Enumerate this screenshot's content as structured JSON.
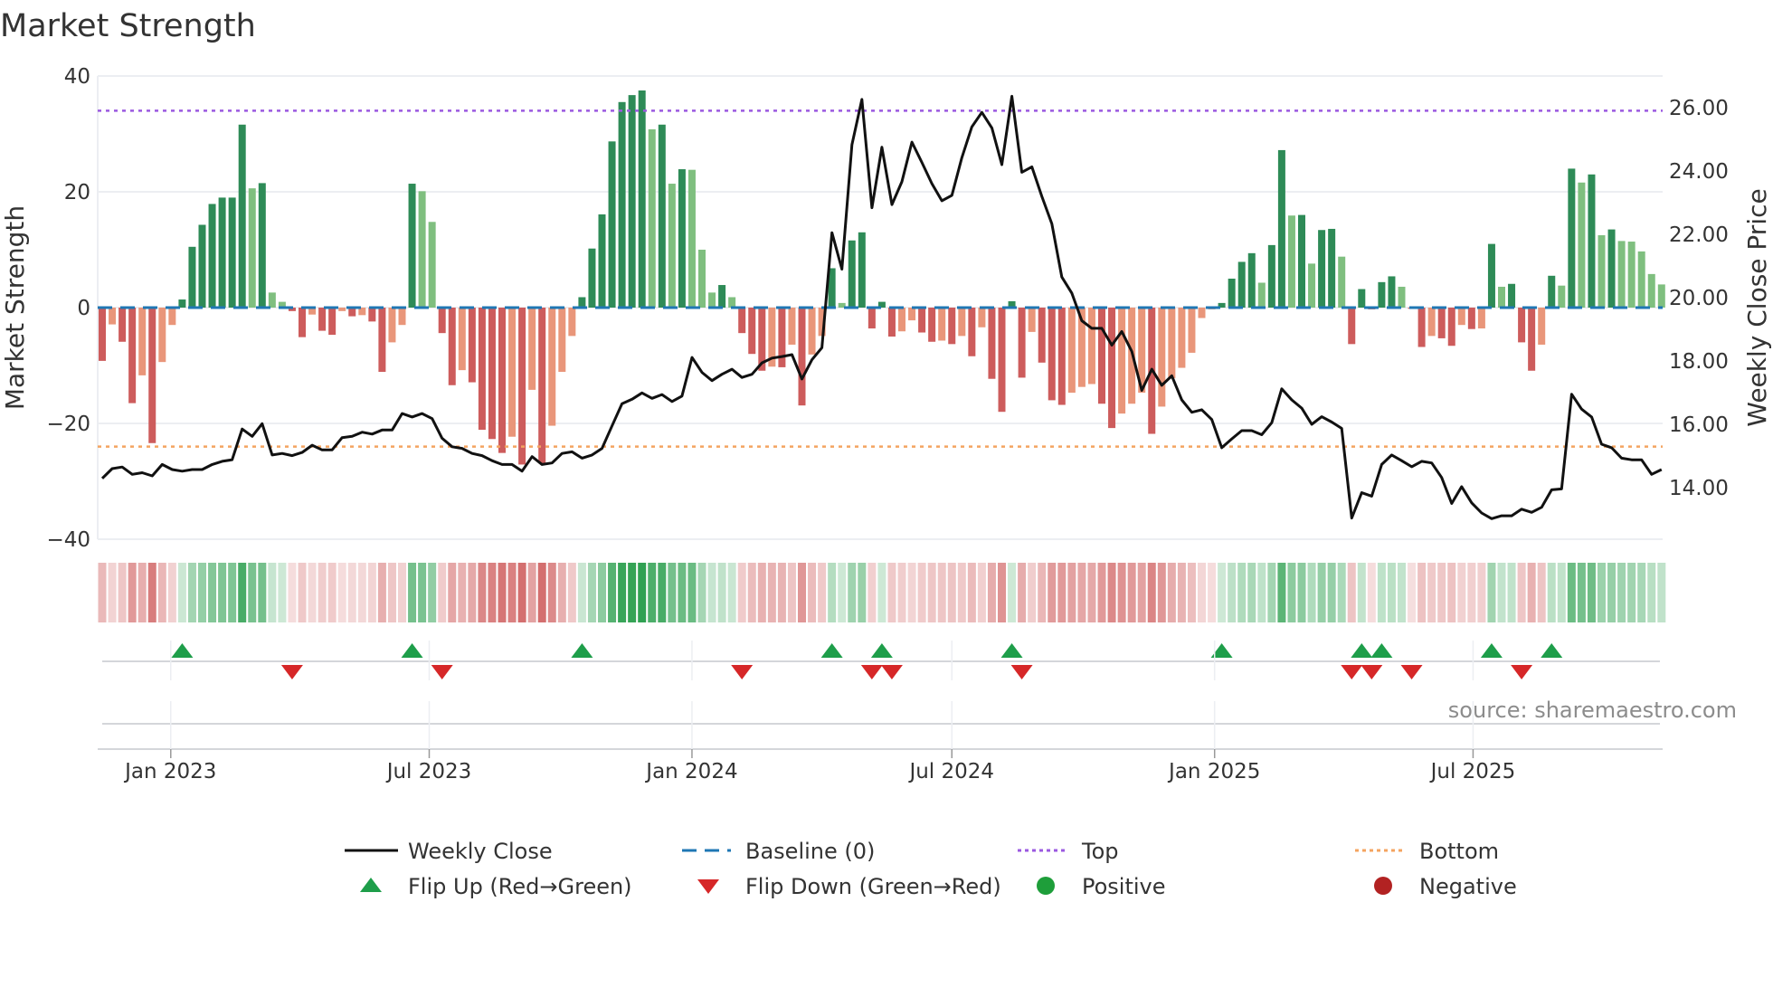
{
  "chart_data": {
    "type": "bar",
    "title": "Market Strength",
    "ylabel": "Market Strength",
    "y2label": "Weekly Close Price",
    "ylim": [
      -40,
      40
    ],
    "y2lim": [
      12.37,
      27.0
    ],
    "yticks": [
      40,
      20,
      0,
      -20,
      -40
    ],
    "y2ticks": [
      14,
      16,
      18,
      20,
      22,
      24,
      26
    ],
    "grid": true,
    "start_date": "2022-11-14",
    "frequency": "weekly",
    "xticks": [
      {
        "date": "2023-01-01",
        "label": "Jan 2023"
      },
      {
        "date": "2023-07-01",
        "label": "Jul 2023"
      },
      {
        "date": "2024-01-01",
        "label": "Jan 2024"
      },
      {
        "date": "2024-07-01",
        "label": "Jul 2024"
      },
      {
        "date": "2025-01-01",
        "label": "Jan 2025"
      },
      {
        "date": "2025-07-01",
        "label": "Jul 2025"
      }
    ],
    "top_level": 34,
    "bottom_level": -24,
    "baseline": 0,
    "strength": [
      -9.2,
      -2.9,
      -5.9,
      -16.5,
      -11.7,
      -23.4,
      -9.4,
      -3.0,
      1.4,
      10.5,
      14.3,
      17.9,
      19.0,
      19.0,
      31.6,
      20.6,
      21.5,
      2.6,
      1.0,
      -0.6,
      -5.1,
      -1.2,
      -4.0,
      -4.7,
      -0.6,
      -1.5,
      -1.3,
      -2.4,
      -11.1,
      -6.0,
      -3.0,
      21.4,
      20.1,
      14.8,
      -4.4,
      -13.4,
      -10.8,
      -12.9,
      -21.1,
      -22.7,
      -25.1,
      -22.3,
      -27.1,
      -14.2,
      -26.9,
      -20.4,
      -11.1,
      -4.9,
      1.8,
      10.2,
      16.1,
      28.7,
      35.5,
      36.7,
      37.5,
      30.8,
      31.6,
      21.4,
      23.9,
      23.8,
      10.0,
      2.6,
      3.9,
      1.8,
      -4.4,
      -8.0,
      -10.9,
      -10.2,
      -10.3,
      -6.4,
      -16.9,
      -8.1,
      -4.9,
      6.8,
      0.8,
      11.6,
      13.0,
      -3.6,
      1.0,
      -5.0,
      -4.1,
      -2.2,
      -4.3,
      -5.9,
      -5.7,
      -6.3,
      -4.9,
      -8.4,
      -3.4,
      -12.3,
      -18.0,
      1.1,
      -12.1,
      -4.2,
      -9.5,
      -16.0,
      -16.8,
      -14.7,
      -13.7,
      -13.2,
      -16.6,
      -20.8,
      -18.3,
      -16.6,
      -14.7,
      -21.8,
      -17.1,
      -12.2,
      -10.4,
      -7.8,
      -1.8,
      -0.3,
      0.8,
      5.0,
      7.9,
      9.4,
      4.3,
      10.8,
      27.2,
      15.9,
      16.0,
      7.6,
      13.4,
      13.6,
      8.8,
      -6.3,
      3.2,
      -0.3,
      4.4,
      5.4,
      3.6,
      -0.2,
      -6.8,
      -4.9,
      -5.3,
      -6.6,
      -3.0,
      -3.7,
      -3.6,
      11.0,
      3.6,
      4.1,
      -6.0,
      -10.9,
      -6.4,
      5.5,
      3.8,
      24.0,
      21.6,
      23.0,
      12.5,
      13.5,
      11.5,
      11.4,
      9.7,
      5.8,
      4.0
    ],
    "weekly_close": [
      14.29,
      14.6,
      14.65,
      14.42,
      14.47,
      14.37,
      14.73,
      14.57,
      14.52,
      14.57,
      14.57,
      14.73,
      14.83,
      14.88,
      15.85,
      15.62,
      16.02,
      15.03,
      15.08,
      15.01,
      15.11,
      15.34,
      15.19,
      15.19,
      15.58,
      15.62,
      15.75,
      15.69,
      15.82,
      15.82,
      16.34,
      16.23,
      16.34,
      16.18,
      15.56,
      15.29,
      15.24,
      15.08,
      15.01,
      14.85,
      14.73,
      14.73,
      14.52,
      14.98,
      14.73,
      14.78,
      15.08,
      15.13,
      14.93,
      15.03,
      15.24,
      15.95,
      16.65,
      16.79,
      16.99,
      16.82,
      16.94,
      16.72,
      16.89,
      18.11,
      17.64,
      17.38,
      17.58,
      17.74,
      17.48,
      17.58,
      17.94,
      18.09,
      18.14,
      18.2,
      17.43,
      18.04,
      18.42,
      22.05,
      20.9,
      24.83,
      26.26,
      22.84,
      24.75,
      22.94,
      23.66,
      24.91,
      24.27,
      23.6,
      23.06,
      23.23,
      24.42,
      25.39,
      25.85,
      25.36,
      24.2,
      26.36,
      23.96,
      24.13,
      23.2,
      22.33,
      20.65,
      20.14,
      19.27,
      19.03,
      19.03,
      18.5,
      18.93,
      18.3,
      17.07,
      17.74,
      17.23,
      17.53,
      16.77,
      16.38,
      16.46,
      16.15,
      15.26,
      15.54,
      15.8,
      15.8,
      15.67,
      16.05,
      17.12,
      16.77,
      16.51,
      16.0,
      16.24,
      16.07,
      15.87,
      13.04,
      13.84,
      13.73,
      14.73,
      15.03,
      14.85,
      14.66,
      14.83,
      14.78,
      14.32,
      13.5,
      14.03,
      13.52,
      13.2,
      13.02,
      13.11,
      13.11,
      13.32,
      13.22,
      13.38,
      13.93,
      13.96,
      16.95,
      16.48,
      16.23,
      15.37,
      15.26,
      14.93,
      14.88,
      14.88,
      14.42,
      14.57
    ],
    "legend": {
      "placement": "bottom",
      "entries": [
        "Weekly Close",
        "Baseline (0)",
        "Top",
        "Bottom",
        "Flip Up (Red→Green)",
        "Flip Down (Green→Red)",
        "Positive",
        "Negative"
      ]
    },
    "source": "source: sharemaestro.com"
  },
  "colors": {
    "pos_strong": "#2e8b57",
    "pos_weak": "#7fbf7f",
    "neg_strong": "#cd5c5c",
    "neg_weak": "#e9967a",
    "line": "#111111",
    "baseline": "#1f77b4",
    "top": "#9b59e0",
    "bottom": "#f4a460",
    "flip_up": "#1e9e4a",
    "flip_down": "#d62728",
    "positive": "#1e9e3a",
    "negative": "#b22222"
  }
}
